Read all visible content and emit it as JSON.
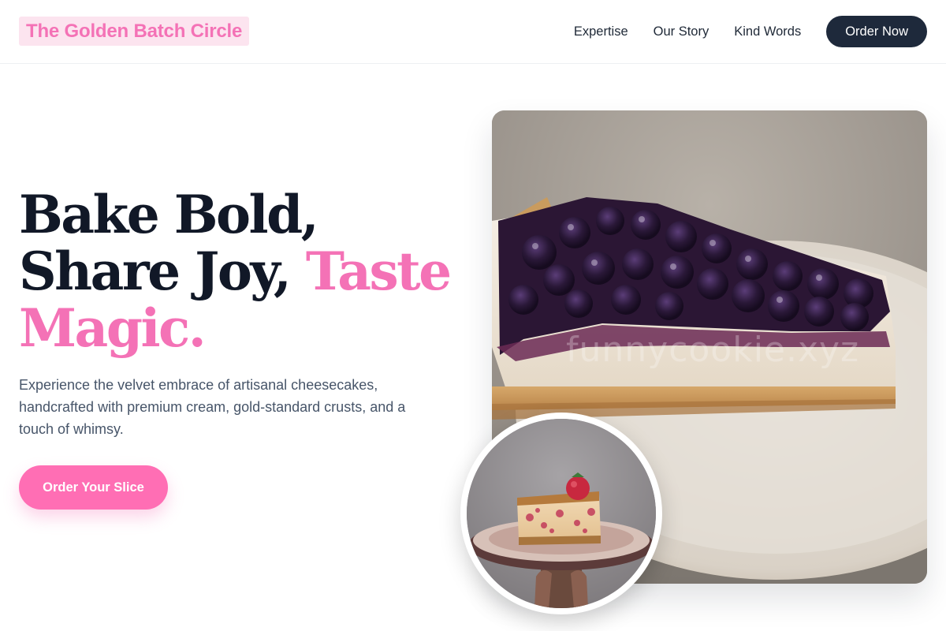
{
  "header": {
    "brand": "The Golden Batch Circle",
    "nav": [
      "Expertise",
      "Our Story",
      "Kind Words"
    ],
    "order_button": "Order Now"
  },
  "hero": {
    "headline_line1": "Bake Bold,",
    "headline_line2_plain": "Share Joy, ",
    "headline_line2_accent": "Taste",
    "headline_line3_accent": "Magic.",
    "lead": "Experience the velvet embrace of artisanal cheesecakes, handcrafted with premium cream, gold-standard crusts, and a touch of whimsy.",
    "cta": "Order Your Slice",
    "watermark": "funnycookie.xyz"
  },
  "colors": {
    "accent_pink": "#f472b6",
    "navy": "#1e293b",
    "cta_pink": "#ff6eb4"
  }
}
